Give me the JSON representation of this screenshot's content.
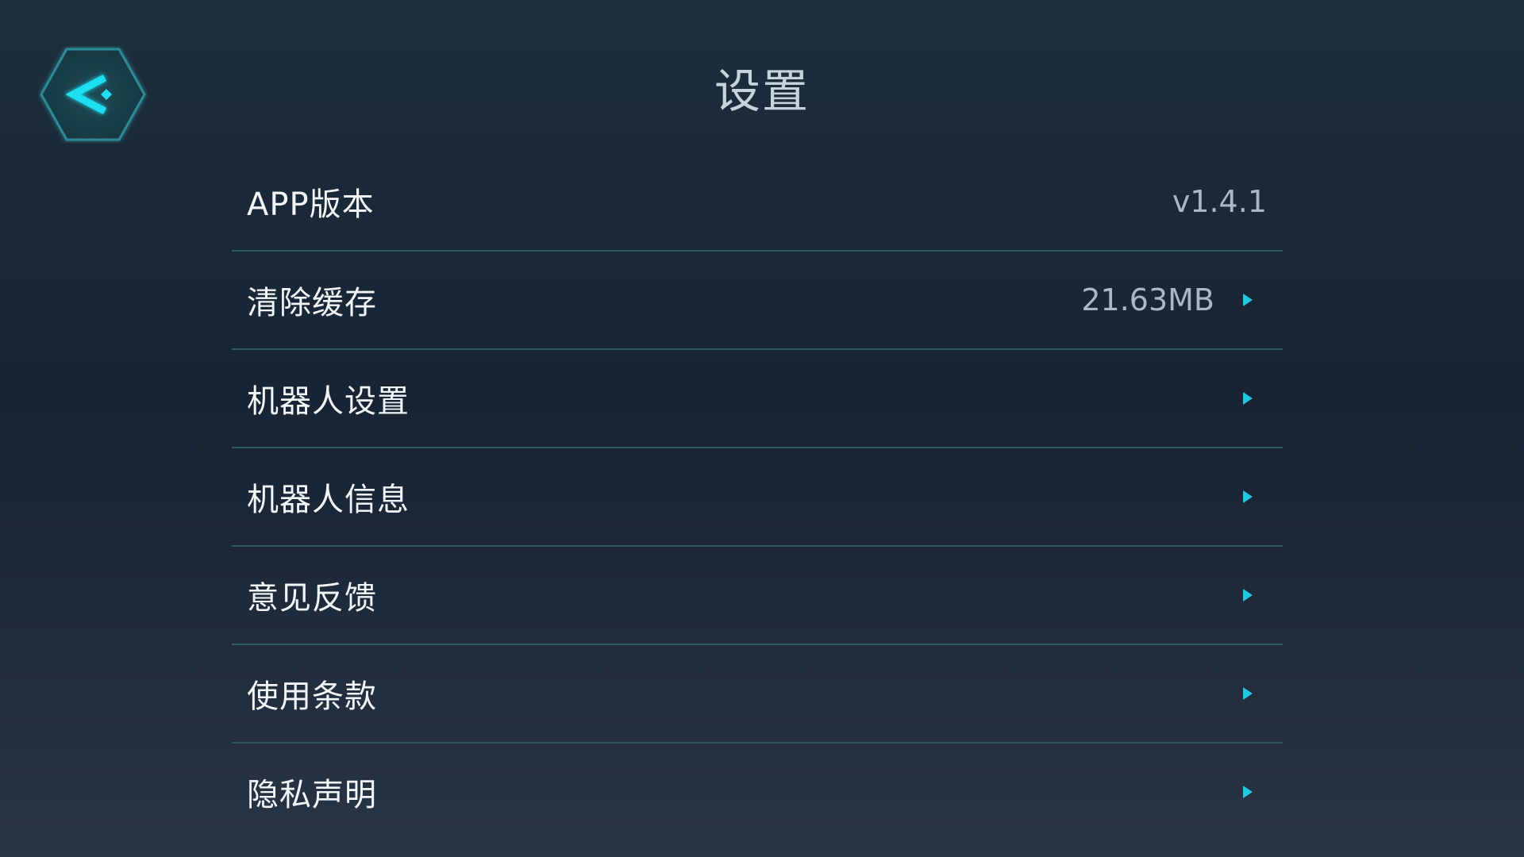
{
  "header": {
    "title": "设置",
    "back_icon": "back-chevron-hexagon-icon"
  },
  "colors": {
    "accent": "#1fc8e6",
    "divider": "#2d5b62",
    "label_text": "#f2f5f8",
    "value_text": "#a8b8c4",
    "title_text": "#c7d3dc"
  },
  "settings": {
    "items": [
      {
        "label": "APP版本",
        "value": "v1.4.1",
        "has_arrow": false
      },
      {
        "label": "清除缓存",
        "value": "21.63MB",
        "has_arrow": true
      },
      {
        "label": "机器人设置",
        "value": "",
        "has_arrow": true
      },
      {
        "label": "机器人信息",
        "value": "",
        "has_arrow": true
      },
      {
        "label": "意见反馈",
        "value": "",
        "has_arrow": true
      },
      {
        "label": "使用条款",
        "value": "",
        "has_arrow": true
      },
      {
        "label": "隐私声明",
        "value": "",
        "has_arrow": true
      }
    ]
  }
}
